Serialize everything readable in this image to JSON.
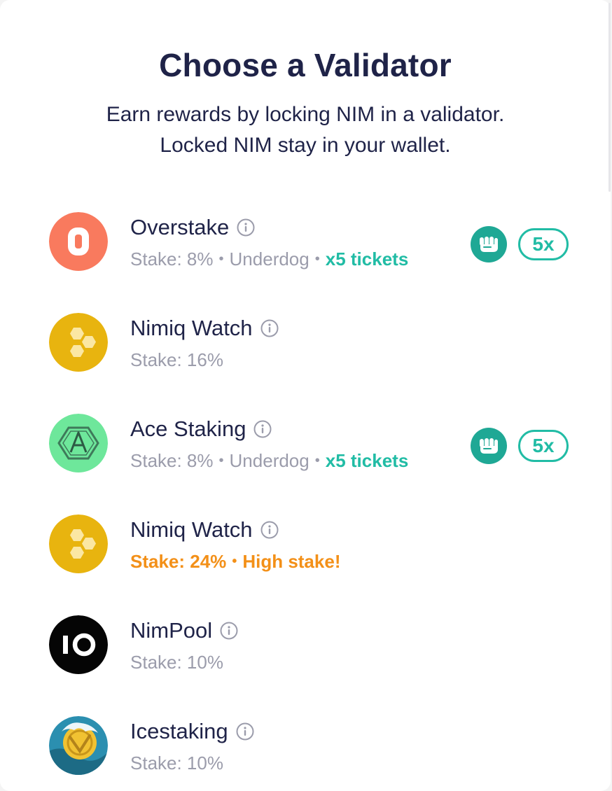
{
  "header": {
    "title": "Choose a Validator",
    "subtitle": "Earn rewards by locking NIM in a validator. Locked NIM stay in your wallet."
  },
  "validators": [
    {
      "name": "Overstake",
      "logo_icon": "overstake-logo",
      "stake": "Stake: 8%",
      "dot": "•",
      "status": "Underdog",
      "tickets": "x5 tickets",
      "multiplier": "5x",
      "badge_icon": "fist-icon"
    },
    {
      "name": "Nimiq Watch",
      "logo_icon": "hexagon-honeycomb-logo",
      "stake": "Stake: 16%"
    },
    {
      "name": "Ace Staking",
      "logo_icon": "ace-staking-logo",
      "stake": "Stake: 8%",
      "dot": "•",
      "status": "Underdog",
      "tickets": "x5 tickets",
      "multiplier": "5x",
      "badge_icon": "fist-icon"
    },
    {
      "name": "Nimiq Watch",
      "logo_icon": "hexagon-honeycomb-logo",
      "stake": "Stake: 24%",
      "dot": "•",
      "warning": "High stake!"
    },
    {
      "name": "NimPool",
      "logo_icon": "nimpool-logo",
      "stake": "Stake: 10%"
    },
    {
      "name": "Icestaking",
      "logo_icon": "icestaking-logo",
      "stake": "Stake: 10%"
    }
  ],
  "colors": {
    "navy": "#1f2348",
    "gray": "#9b9cab",
    "green": "#21bca5",
    "orange": "#f39018",
    "overstake": "#f97a5e",
    "gold": "#e8b40f"
  }
}
